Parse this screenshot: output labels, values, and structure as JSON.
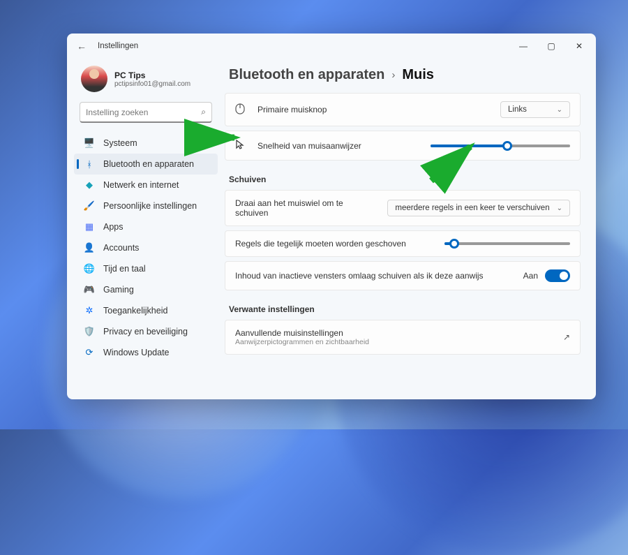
{
  "window": {
    "title": "Instellingen"
  },
  "profile": {
    "name": "PC Tips",
    "email": "pctipsinfo01@gmail.com"
  },
  "search": {
    "placeholder": "Instelling zoeken"
  },
  "sidebar": {
    "items": [
      {
        "label": "Systeem",
        "icon": "🖥️",
        "color": "#1976d2"
      },
      {
        "label": "Bluetooth en apparaten",
        "icon": "ᚼ",
        "color": "#0067c0"
      },
      {
        "label": "Netwerk en internet",
        "icon": "◆",
        "color": "#17a2b8"
      },
      {
        "label": "Persoonlijke instellingen",
        "icon": "🖌️",
        "color": "#c94f7c"
      },
      {
        "label": "Apps",
        "icon": "▦",
        "color": "#4c6ef5"
      },
      {
        "label": "Accounts",
        "icon": "👤",
        "color": "#28a745"
      },
      {
        "label": "Tijd en taal",
        "icon": "🌐",
        "color": "#e8a33d"
      },
      {
        "label": "Gaming",
        "icon": "🎮",
        "color": "#6f42c1"
      },
      {
        "label": "Toegankelijkheid",
        "icon": "✲",
        "color": "#0d6efd"
      },
      {
        "label": "Privacy en beveiliging",
        "icon": "🛡️",
        "color": "#6c757d"
      },
      {
        "label": "Windows Update",
        "icon": "⟳",
        "color": "#0067c0"
      }
    ]
  },
  "breadcrumb": {
    "parent": "Bluetooth en apparaten",
    "current": "Muis"
  },
  "mouse": {
    "primary_button": {
      "label": "Primaire muisknop",
      "value": "Links"
    },
    "pointer_speed": {
      "label": "Snelheid van muisaanwijzer",
      "value_pct": 55
    },
    "scrolling": {
      "title": "Schuiven",
      "wheel": {
        "label": "Draai aan het muiswiel om te schuiven",
        "value": "meerdere regels in een keer te verschuiven"
      },
      "lines": {
        "label": "Regels die tegelijk moeten worden geschoven",
        "value_pct": 8
      },
      "inactive": {
        "label": "Inhoud van inactieve vensters omlaag schuiven als ik deze aanwijs",
        "state": "Aan"
      }
    },
    "related": {
      "title": "Verwante instellingen",
      "additional": {
        "label": "Aanvullende muisinstellingen",
        "sub": "Aanwijzerpictogrammen en zichtbaarheid"
      }
    }
  }
}
